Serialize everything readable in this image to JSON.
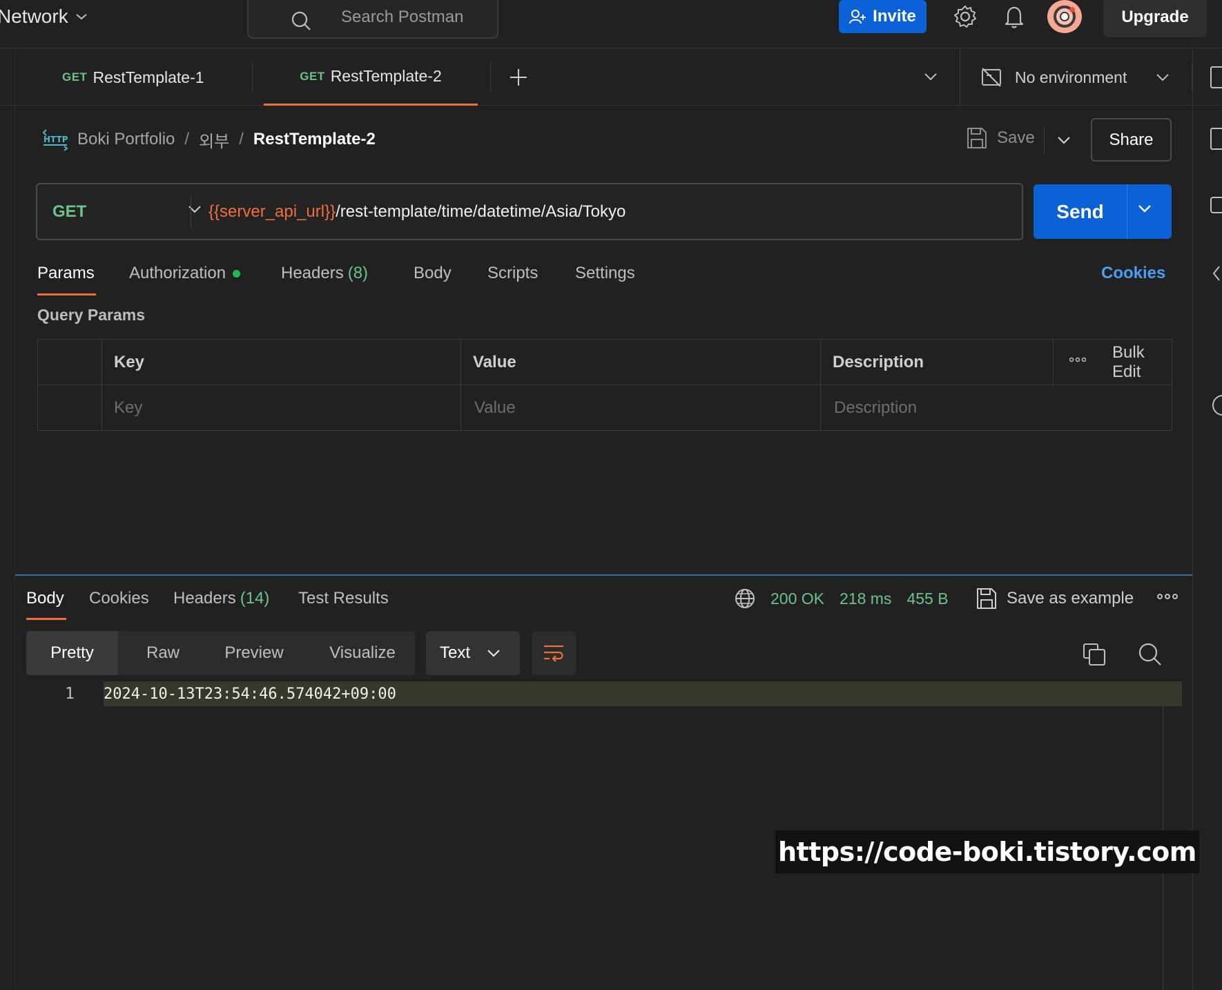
{
  "topbar": {
    "workspace": "Network",
    "search_placeholder": "Search Postman",
    "invite_label": "Invite",
    "upgrade_label": "Upgrade"
  },
  "tabs": [
    {
      "method": "GET",
      "name": "RestTemplate-1"
    },
    {
      "method": "GET",
      "name": "RestTemplate-2"
    }
  ],
  "environment": {
    "label": "No environment"
  },
  "breadcrumb": {
    "collection": "Boki Portfolio",
    "folder": "외부",
    "request": "RestTemplate-2"
  },
  "actions": {
    "save_label": "Save",
    "share_label": "Share"
  },
  "request": {
    "method": "GET",
    "url_variable": "{{server_api_url}}",
    "url_path": "/rest-template/time/datetime/Asia/Tokyo",
    "send_label": "Send"
  },
  "request_tabs": {
    "params": "Params",
    "authorization": "Authorization",
    "headers": "Headers",
    "headers_count": "(8)",
    "body": "Body",
    "scripts": "Scripts",
    "settings": "Settings",
    "cookies": "Cookies"
  },
  "query_params": {
    "title": "Query Params",
    "columns": {
      "key": "Key",
      "value": "Value",
      "description": "Description",
      "bulk_edit": "Bulk Edit"
    },
    "placeholders": {
      "key": "Key",
      "value": "Value",
      "description": "Description"
    }
  },
  "response": {
    "tabs": {
      "body": "Body",
      "cookies": "Cookies",
      "headers": "Headers",
      "headers_count": "(14)",
      "test_results": "Test Results"
    },
    "status": "200 OK",
    "time": "218 ms",
    "size": "455 B",
    "save_as_example": "Save as example",
    "views": {
      "pretty": "Pretty",
      "raw": "Raw",
      "preview": "Preview",
      "visualize": "Visualize"
    },
    "format": "Text",
    "line_number": "1",
    "body_text": "2024-10-13T23:54:46.574042+09:00"
  },
  "watermark": "https://code-boki.tistory.com",
  "colors": {
    "accent_orange": "#f06f3a",
    "primary_blue": "#0b62d6",
    "success_green": "#6cc38b",
    "link_blue": "#4a9ff5"
  }
}
